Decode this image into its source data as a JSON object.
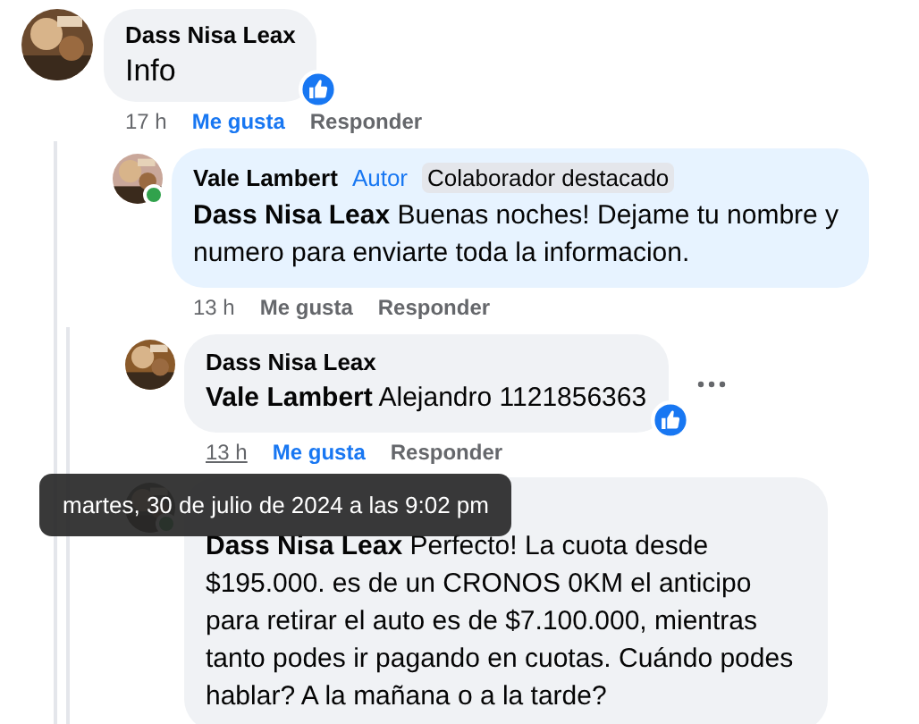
{
  "comments": [
    {
      "author": "Dass Nisa Leax",
      "text": "Info",
      "reacted": true,
      "time": "17 h",
      "like_label": "Me gusta",
      "liked": true,
      "reply_label": "Responder",
      "replies": [
        {
          "author": "Vale Lambert",
          "badges": [
            {
              "kind": "role",
              "label": "Autor"
            },
            {
              "kind": "tag",
              "label": "Colaborador destacado"
            }
          ],
          "mention": "Dass Nisa Leax",
          "text": "Buenas noches! Dejame tu nombre y numero para enviarte toda la informacion.",
          "online": true,
          "highlighted": true,
          "time": "13 h",
          "like_label": "Me gusta",
          "liked": false,
          "reply_label": "Responder",
          "replies": [
            {
              "author": "Dass Nisa Leax",
              "mention": "Vale Lambert",
              "text": "Alejandro 1121856363",
              "reacted": true,
              "more_menu": true,
              "time": "13 h",
              "time_hovered": true,
              "like_label": "Me gusta",
              "liked": true,
              "reply_label": "Responder"
            },
            {
              "mention": "Dass Nisa Leax",
              "text": "Perfecto! La cuota desde $195.000. es de un CRONOS 0KM el anticipo para retirar el auto es de $7.100.000, mientras tanto podes ir pagando en cuotas. Cuándo podes hablar? A la mañana o a la tarde?",
              "online": true
            }
          ]
        }
      ]
    }
  ],
  "tooltip": {
    "text": "martes, 30 de julio de 2024 a las 9:02 pm"
  }
}
